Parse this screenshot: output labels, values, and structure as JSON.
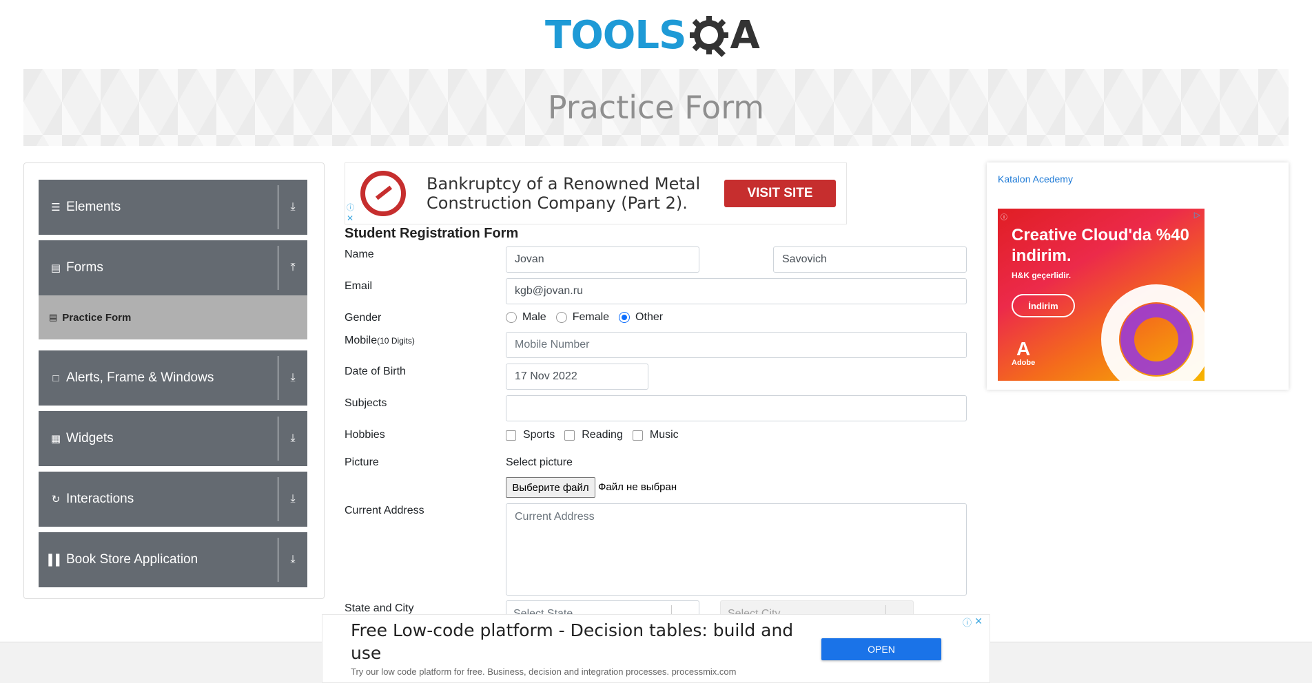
{
  "header": {
    "logo_tools": "TOOLS",
    "logo_qa": "A",
    "logo_q": "Q"
  },
  "banner": {
    "title": "Practice Form"
  },
  "sidebar": {
    "groups": [
      {
        "label": "Elements",
        "icon": "hamburger-icon",
        "arrow": "download-arrow-icon"
      },
      {
        "label": "Forms",
        "icon": "document-icon",
        "arrow": "upload-arrow-icon"
      },
      {
        "label": "Alerts, Frame & Windows",
        "icon": "window-icon",
        "arrow": "download-arrow-icon"
      },
      {
        "label": "Widgets",
        "icon": "widgets-icon",
        "arrow": "download-arrow-icon"
      },
      {
        "label": "Interactions",
        "icon": "interactions-icon",
        "arrow": "download-arrow-icon"
      },
      {
        "label": "Book Store Application",
        "icon": "books-icon",
        "arrow": "download-arrow-icon"
      }
    ],
    "active_item": {
      "label": "Practice Form",
      "icon": "form-icon"
    }
  },
  "top_ad": {
    "text": "Bankruptcy of a Renowned Metal Construction Company (Part 2).",
    "button": "VISIT SITE"
  },
  "form": {
    "title": "Student Registration Form",
    "labels": {
      "name": "Name",
      "email": "Email",
      "gender": "Gender",
      "mobile": "Mobile",
      "mobile_hint": "(10 Digits)",
      "dob": "Date of Birth",
      "subjects": "Subjects",
      "hobbies": "Hobbies",
      "picture": "Picture",
      "address": "Current Address",
      "state_city": "State and City"
    },
    "first_name": "Jovan",
    "last_name": "Savovich",
    "email": "kgb@jovan.ru",
    "gender_options": [
      "Male",
      "Female",
      "Other"
    ],
    "gender_selected": "Other",
    "mobile_placeholder": "Mobile Number",
    "dob": "17 Nov 2022",
    "subjects": "",
    "hobbies": [
      "Sports",
      "Reading",
      "Music"
    ],
    "picture_label": "Select picture",
    "file_button": "Выберите файл",
    "file_status": "Файл не выбран",
    "address_placeholder": "Current Address",
    "state_placeholder": "Select State",
    "city_placeholder": "Select City"
  },
  "right_ad": {
    "link_text": "Katalon Acedemy",
    "headline": "Creative Cloud'da %40 indirim.",
    "subtext": "H&K geçerlidir.",
    "button": "İndirim",
    "brand": "Adobe"
  },
  "bottom_ad": {
    "title": "Free Low-code platform - Decision tables: build and use",
    "subtitle": "Try our low code platform for free. Business, decision and integration processes. processmix.com",
    "button": "OPEN"
  },
  "colors": {
    "sidebar_group": "#646a71",
    "sidebar_active": "#b0b0b0",
    "logo_blue": "#1e9ad6",
    "radio_selected": "#0d6efd",
    "ad_red": "#c62e2e",
    "open_button": "#1a73e8"
  }
}
